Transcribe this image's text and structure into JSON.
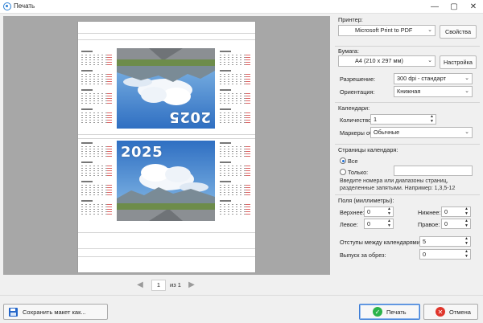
{
  "window": {
    "title": "Печать"
  },
  "pager": {
    "current": "1",
    "of_text": "из 1"
  },
  "preview": {
    "year_top": "2025",
    "year_bottom": "2025"
  },
  "printer": {
    "section_title": "Принтер:",
    "selected": "Microsoft Print to PDF",
    "properties_label": "Свойства"
  },
  "paper": {
    "section_title": "Бумага:",
    "size": "A4 (210 x 297 мм)",
    "setup_label": "Настройка",
    "resolution_label": "Разрешение:",
    "resolution_value": "300 dpi - стандарт",
    "orientation_label": "Ориентация:",
    "orientation_value": "Книжная"
  },
  "calendars": {
    "section_title": "Календари:",
    "count_label": "Количество:",
    "count_value": "1",
    "markers_label": "Маркеры обрезки:",
    "markers_value": "Обычные"
  },
  "pages": {
    "section_title": "Страницы календаря:",
    "all_label": "Все",
    "only_label": "Только:",
    "only_value": "",
    "hint": "Введите номера или диапазоны страниц, разделенные запятыми. Например: 1,3,5-12"
  },
  "margins": {
    "section_title": "Поля (миллиметры):",
    "top_label": "Верхнее:",
    "top_value": "0",
    "bottom_label": "Нижнее:",
    "bottom_value": "0",
    "left_label": "Левое:",
    "left_value": "0",
    "right_label": "Правое:",
    "right_value": "0",
    "spacing_label": "Отступы между календарями:",
    "spacing_value": "5",
    "bleed_label": "Выпуск за обрез:",
    "bleed_value": "0"
  },
  "buttons": {
    "save_layout": "Сохранить макет как...",
    "print": "Печать",
    "cancel": "Отмена"
  },
  "colors": {
    "accent": "#1d6fd6",
    "print_icon": "#2bb34a",
    "cancel_icon": "#e0352b",
    "preview_bg": "#a7a7a7"
  }
}
